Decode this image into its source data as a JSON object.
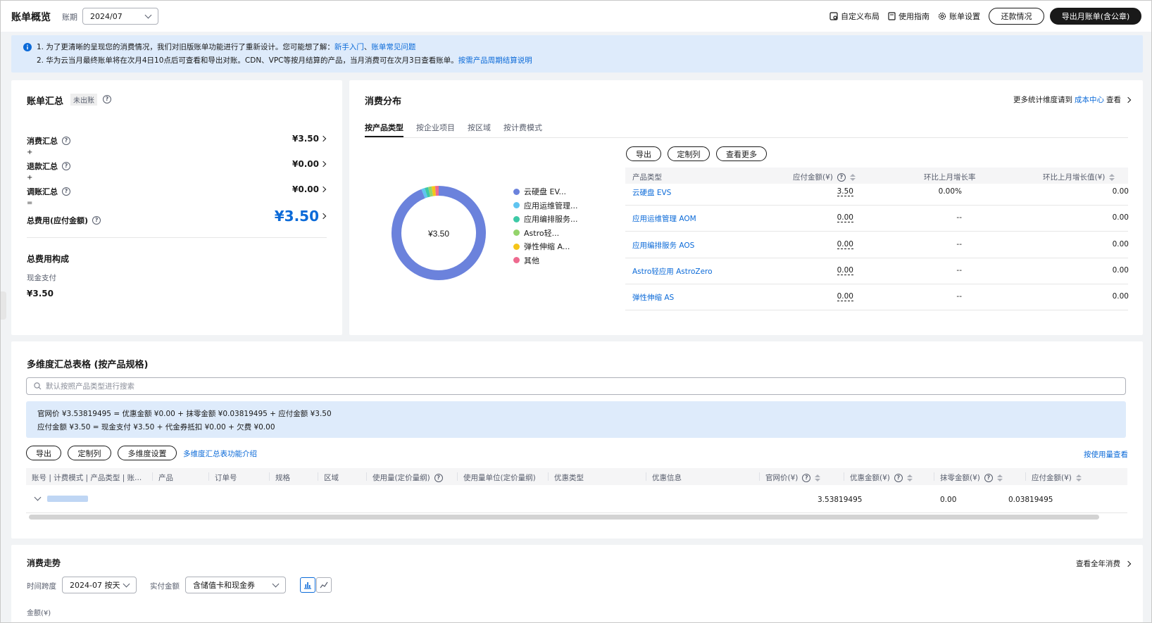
{
  "header": {
    "title": "账单概览",
    "period_label": "账期",
    "period_value": "2024/07",
    "custom_layout": "自定义布局",
    "guide": "使用指南",
    "settings": "账单设置",
    "repay": "还款情况",
    "export_monthly": "导出月账单(含公章)"
  },
  "notice": {
    "line1_text": "1. 为了更清晰的呈现您的消费情况，我们对旧版账单功能进行了重新设计。您可能想了解：",
    "line1_link1": "新手入门",
    "line1_sep": "、",
    "line1_link2": "账单常见问题",
    "line2_text": "2. 华为云当月最终账单将在次月4日10点后可查看和导出对账。CDN、VPC等按月结算的产品，当月消费可在次月3日查看账单。",
    "line2_link": "按需产品周期结算说明"
  },
  "summary": {
    "title": "账单汇总",
    "status": "未出账",
    "consumption_label": "消费汇总",
    "consumption_value": "¥3.50",
    "refund_label": "退款汇总",
    "refund_value": "¥0.00",
    "adjust_label": "调账汇总",
    "adjust_value": "¥0.00",
    "total_label": "总费用(应付金额)",
    "total_value": "¥3.50",
    "plus1": "+",
    "plus2": "+",
    "equals": "=",
    "composition_title": "总费用构成",
    "cash_label": "现金支付",
    "cash_value": "¥3.50"
  },
  "distribution": {
    "title": "消费分布",
    "more_text": "更多统计维度请到",
    "more_link": "成本中心",
    "more_view": "查看",
    "tabs": [
      "按产品类型",
      "按企业项目",
      "按区域",
      "按计费模式"
    ],
    "center_value": "¥3.50",
    "legend": [
      {
        "label": "云硬盘 EV...",
        "color": "#6b82dc"
      },
      {
        "label": "应用运维管理...",
        "color": "#5fc4f0"
      },
      {
        "label": "应用编排服务...",
        "color": "#3dc9a6"
      },
      {
        "label": "Astro轻...",
        "color": "#94d46b"
      },
      {
        "label": "弹性伸缩 A...",
        "color": "#f5c518"
      },
      {
        "label": "其他",
        "color": "#ee6a8f"
      }
    ],
    "chart_data": {
      "type": "pie",
      "categories": [
        "云硬盘 EVS",
        "应用运维管理 AOM",
        "应用编排服务 AOS",
        "Astro轻应用 AstroZero",
        "弹性伸缩 AS",
        "其他"
      ],
      "values": [
        3.5,
        0.0,
        0.0,
        0.0,
        0.0,
        0.0
      ]
    },
    "buttons": {
      "export": "导出",
      "customize": "定制列",
      "view_more": "查看更多"
    },
    "columns": [
      "产品类型",
      "应付金额(¥)",
      "环比上月增长率",
      "环比上月增长值(¥)"
    ],
    "rows": [
      {
        "product": "云硬盘 EVS",
        "amount": "3.50",
        "rate": "0.00%",
        "delta": "0.00"
      },
      {
        "product": "应用运维管理 AOM",
        "amount": "0.00",
        "rate": "--",
        "delta": "0.00"
      },
      {
        "product": "应用编排服务 AOS",
        "amount": "0.00",
        "rate": "--",
        "delta": "0.00"
      },
      {
        "product": "Astro轻应用 AstroZero",
        "amount": "0.00",
        "rate": "--",
        "delta": "0.00"
      },
      {
        "product": "弹性伸缩 AS",
        "amount": "0.00",
        "rate": "--",
        "delta": "0.00"
      }
    ]
  },
  "multi": {
    "title": "多维度汇总表格 (按产品规格)",
    "search_placeholder": "默认按照产品类型进行搜索",
    "formula1": "官网价 ¥3.53819495 = 优惠金额 ¥0.00 + 抹零金额 ¥0.03819495 + 应付金额 ¥3.50",
    "formula2": "应付金额 ¥3.50 = 现金支付 ¥3.50 + 代金券抵扣 ¥0.00 + 欠费 ¥0.00",
    "btn_export": "导出",
    "btn_customize": "定制列",
    "btn_dims": "多维度设置",
    "intro_link": "多维度汇总表功能介绍",
    "usage_link": "按使用量查看",
    "columns": [
      "账号 | 计费模式 | 产品类型 | 账...",
      "产品",
      "订单号",
      "规格",
      "区域",
      "使用量(定价量纲)",
      "使用量单位(定价量纲)",
      "优惠类型",
      "优惠信息",
      "官网价(¥)",
      "优惠金额(¥)",
      "抹零金额(¥)",
      "应付金额(¥)"
    ],
    "row": {
      "list_price": "3.53819495",
      "discount": "0.00",
      "rounding": "0.03819495"
    }
  },
  "trend": {
    "title": "消费走势",
    "view_year": "查看全年消费",
    "span_label": "时间跨度",
    "span_value": "2024-07 按天",
    "amount_label": "实付金额",
    "amount_value": "含储值卡和现金券",
    "yaxis_label": "金额(¥)"
  }
}
